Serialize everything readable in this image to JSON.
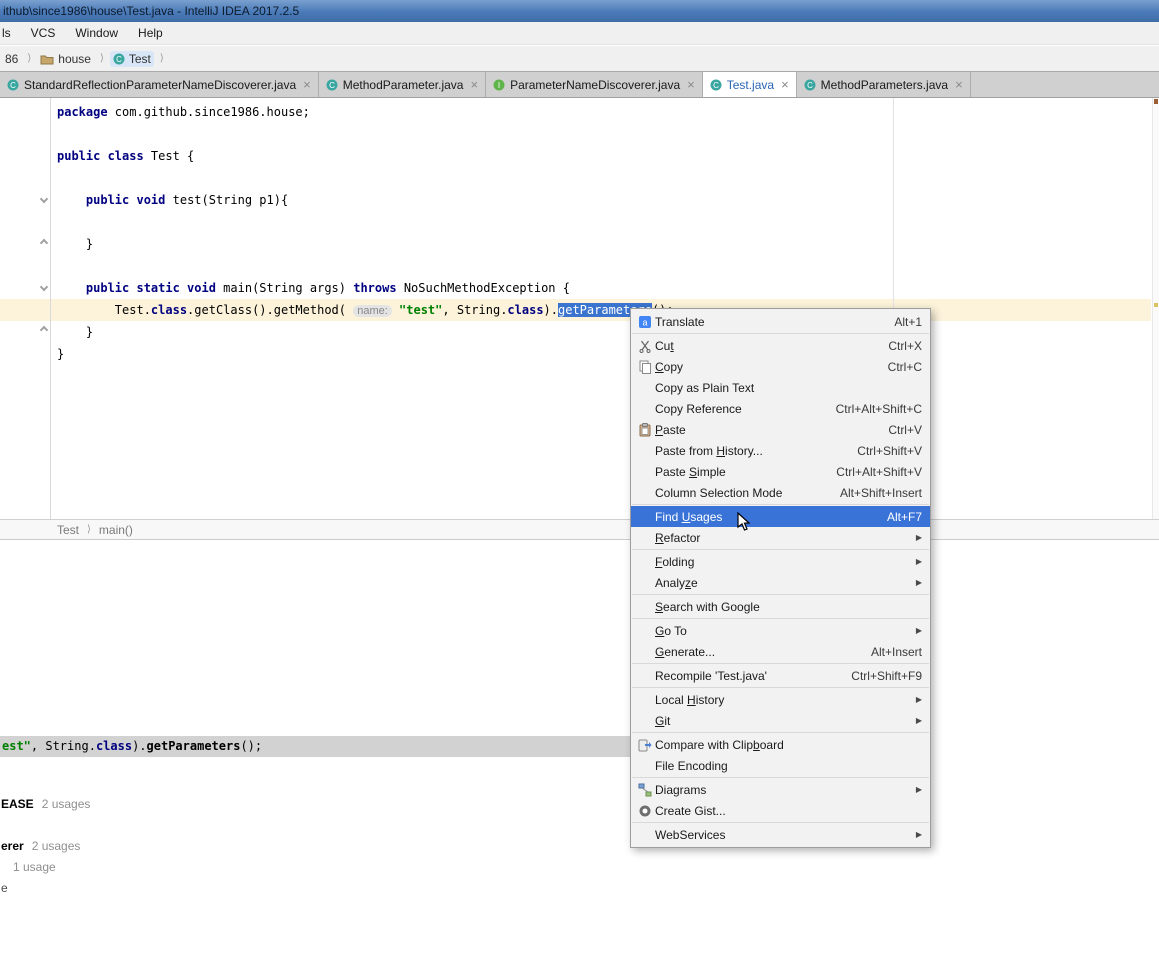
{
  "window": {
    "title": "ithub\\since1986\\house\\Test.java - IntelliJ IDEA 2017.2.5"
  },
  "menubar": {
    "items": [
      "ls",
      "VCS",
      "Window",
      "Help"
    ]
  },
  "breadcrumb": {
    "items": [
      {
        "label": "86",
        "icon": null,
        "selected": false
      },
      {
        "label": "house",
        "icon": "folder",
        "selected": false
      },
      {
        "label": "Test",
        "icon": "class",
        "selected": true
      }
    ]
  },
  "tabs": [
    {
      "label": "StandardReflectionParameterNameDiscoverer.java",
      "icon": "class",
      "active": false
    },
    {
      "label": "MethodParameter.java",
      "icon": "class",
      "active": false
    },
    {
      "label": "ParameterNameDiscoverer.java",
      "icon": "interface",
      "active": false
    },
    {
      "label": "Test.java",
      "icon": "class",
      "active": true
    },
    {
      "label": "MethodParameters.java",
      "icon": "class",
      "active": false
    }
  ],
  "editor": {
    "code_lines": [
      {
        "segments": [
          {
            "t": "package",
            "s": "kw"
          },
          {
            "t": " com.github.since1986.house;",
            "s": "plain"
          }
        ]
      },
      {
        "segments": []
      },
      {
        "segments": [
          {
            "t": "public class",
            "s": "kw"
          },
          {
            "t": " Test {",
            "s": "plain"
          }
        ]
      },
      {
        "segments": []
      },
      {
        "segments": [
          {
            "t": "    ",
            "s": "plain"
          },
          {
            "t": "public void",
            "s": "kw"
          },
          {
            "t": " test(String p1){",
            "s": "plain"
          }
        ]
      },
      {
        "segments": []
      },
      {
        "segments": [
          {
            "t": "    }",
            "s": "plain"
          }
        ]
      },
      {
        "segments": []
      },
      {
        "segments": [
          {
            "t": "    ",
            "s": "plain"
          },
          {
            "t": "public static void",
            "s": "kw"
          },
          {
            "t": " main(String args) ",
            "s": "plain"
          },
          {
            "t": "throws",
            "s": "kw"
          },
          {
            "t": " NoSuchMethodException {",
            "s": "plain"
          }
        ]
      },
      {
        "segments": [
          {
            "t": "        Test.",
            "s": "plain"
          },
          {
            "t": "class",
            "s": "kw"
          },
          {
            "t": ".getClass().getMethod( ",
            "s": "plain"
          },
          {
            "t": "name:",
            "s": "hint"
          },
          {
            "t": " ",
            "s": "plain"
          },
          {
            "t": "\"test\"",
            "s": "str"
          },
          {
            "t": ", String.",
            "s": "plain"
          },
          {
            "t": "class",
            "s": "kw"
          },
          {
            "t": ").",
            "s": "plain"
          },
          {
            "t": "getParameters",
            "s": "sel"
          },
          {
            "t": "();",
            "s": "plain"
          }
        ],
        "current": true
      },
      {
        "segments": [
          {
            "t": "    }",
            "s": "plain"
          }
        ]
      },
      {
        "segments": [
          {
            "t": "}",
            "s": "plain"
          }
        ]
      }
    ]
  },
  "editor_breadcrumb": {
    "items": [
      "Test",
      "main()"
    ]
  },
  "preview": {
    "segments": [
      {
        "t": "est\"",
        "s": "str"
      },
      {
        "t": ", String.",
        "s": "plain"
      },
      {
        "t": "class",
        "s": "kw"
      },
      {
        "t": ").",
        "s": "plain"
      },
      {
        "t": "getParameters",
        "s": "bold"
      },
      {
        "t": "();",
        "s": "plain"
      }
    ]
  },
  "usages": {
    "items": [
      {
        "label": "EASE",
        "count": "2 usages",
        "style": "bold"
      },
      {
        "label": "erer",
        "count": "2 usages",
        "style": "bold"
      },
      {
        "label": "1 usage",
        "count": "",
        "style": "gray"
      },
      {
        "label": "e",
        "count": "",
        "style": "plain"
      }
    ]
  },
  "context_menu": {
    "items": [
      {
        "label": "Translate",
        "shortcut": "Alt+1",
        "icon": "translate"
      },
      {
        "sep": true
      },
      {
        "label": "Cut",
        "shortcut": "Ctrl+X",
        "icon": "cut",
        "m": 2
      },
      {
        "label": "Copy",
        "shortcut": "Ctrl+C",
        "icon": "copy",
        "m": 0
      },
      {
        "label": "Copy as Plain Text"
      },
      {
        "label": "Copy Reference",
        "shortcut": "Ctrl+Alt+Shift+C"
      },
      {
        "label": "Paste",
        "shortcut": "Ctrl+V",
        "icon": "paste",
        "m": 0
      },
      {
        "label": "Paste from History...",
        "shortcut": "Ctrl+Shift+V",
        "m": 11
      },
      {
        "label": "Paste Simple",
        "shortcut": "Ctrl+Alt+Shift+V",
        "m": 6
      },
      {
        "label": "Column Selection Mode",
        "shortcut": "Alt+Shift+Insert"
      },
      {
        "sep": true
      },
      {
        "label": "Find Usages",
        "shortcut": "Alt+F7",
        "selected": true,
        "m": 5
      },
      {
        "label": "Refactor",
        "submenu": true,
        "m": 0
      },
      {
        "sep": true
      },
      {
        "label": "Folding",
        "submenu": true,
        "m": 0
      },
      {
        "label": "Analyze",
        "submenu": true,
        "m": 5
      },
      {
        "sep": true
      },
      {
        "label": "Search with Google",
        "m": 0
      },
      {
        "sep": true
      },
      {
        "label": "Go To",
        "submenu": true,
        "m": 0
      },
      {
        "label": "Generate...",
        "shortcut": "Alt+Insert",
        "m": 0
      },
      {
        "sep": true
      },
      {
        "label": "Recompile 'Test.java'",
        "shortcut": "Ctrl+Shift+F9"
      },
      {
        "sep": true
      },
      {
        "label": "Local History",
        "submenu": true,
        "m": 6
      },
      {
        "label": "Git",
        "submenu": true,
        "m": 0
      },
      {
        "sep": true
      },
      {
        "label": "Compare with Clipboard",
        "icon": "compare",
        "m": 17
      },
      {
        "label": "File Encoding"
      },
      {
        "sep": true
      },
      {
        "label": "Diagrams",
        "submenu": true,
        "icon": "diagrams"
      },
      {
        "label": "Create Gist...",
        "icon": "gist"
      },
      {
        "sep": true
      },
      {
        "label": "WebServices",
        "submenu": true
      }
    ]
  },
  "colors": {
    "selection": "#3b74cf",
    "menu_selected": "#3a73d8",
    "keyword": "#000080",
    "string": "#008000",
    "current_line": "#fcf3da",
    "titlebar": "#4a7ab8",
    "tab_active_text": "#2a66b5"
  }
}
